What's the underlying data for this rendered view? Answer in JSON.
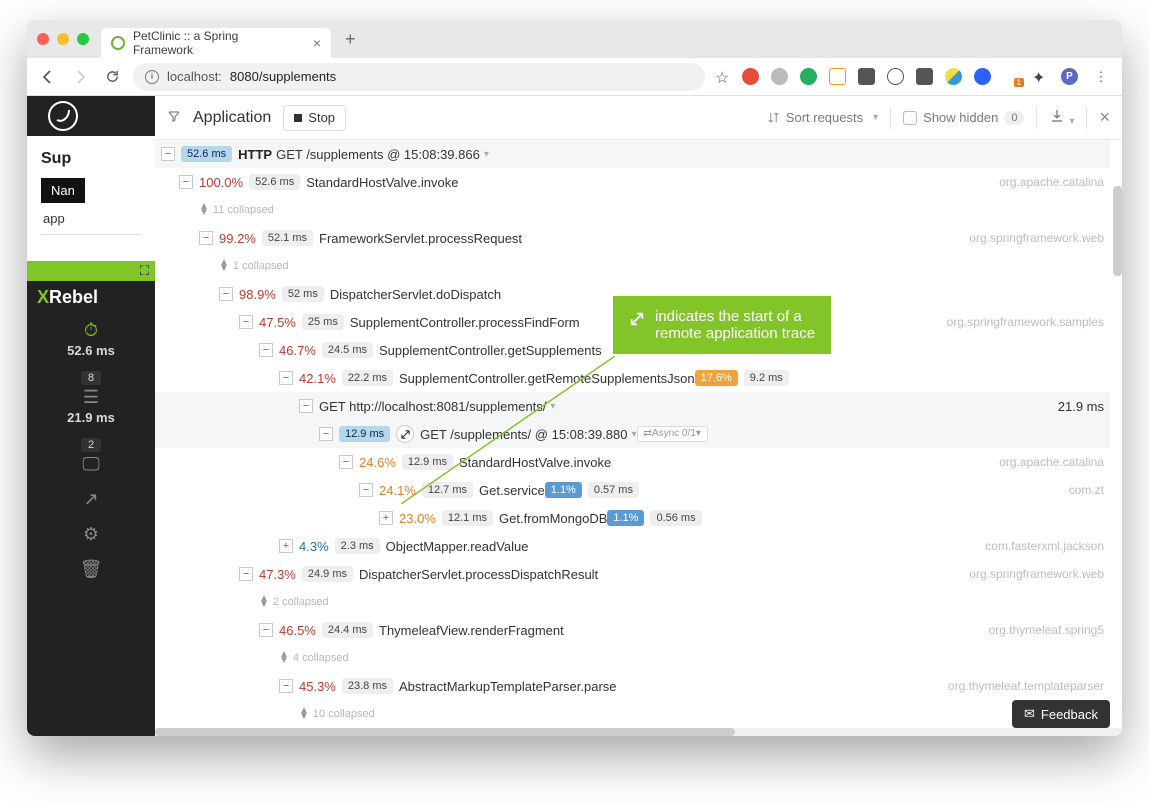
{
  "browser": {
    "tab_title": "PetClinic :: a Spring Framework",
    "url_host": "localhost:",
    "url_port_path": "8080/supplements"
  },
  "toolbar": {
    "title": "Application",
    "stop_label": "Stop",
    "sort_label": "Sort requests",
    "show_hidden_label": "Show hidden",
    "show_hidden_count": "0"
  },
  "xrebel": {
    "brand_prefix": "X",
    "brand_rest": "Rebel",
    "timer_ms": "52.6 ms",
    "db_badge": "8",
    "db_ms": "21.9 ms",
    "screen_badge": "2"
  },
  "sidebar": {
    "title": "Sup",
    "tab_label": "Nan",
    "tab_value": "app"
  },
  "callout": {
    "text1": "indicates the start of a",
    "text2": "remote application trace"
  },
  "feedback_label": "Feedback",
  "trace": {
    "root": {
      "ms": "52.6 ms",
      "proto": "HTTP",
      "req": "GET /supplements @ 15:08:39.866"
    },
    "r1": {
      "pct": "100.0%",
      "ms": "52.6 ms",
      "method": "StandardHostValve.invoke",
      "pkg": "org.apache.catalina"
    },
    "c1": "11 collapsed",
    "r2": {
      "pct": "99.2%",
      "ms": "52.1 ms",
      "method": "FrameworkServlet.processRequest",
      "pkg": "org.springframework.web"
    },
    "c2": "1 collapsed",
    "r3": {
      "pct": "98.9%",
      "ms": "52 ms",
      "method": "DispatcherServlet.doDispatch"
    },
    "r4": {
      "pct": "47.5%",
      "ms": "25 ms",
      "method": "SupplementController.processFindForm",
      "pkg": "org.springframework.samples"
    },
    "r5": {
      "pct": "46.7%",
      "ms": "24.5 ms",
      "method": "SupplementController.getSupplements"
    },
    "r6": {
      "pct": "42.1%",
      "ms": "22.2 ms",
      "method": "SupplementController.getRemoteSupplementsJson",
      "badge_pct": "17.6%",
      "badge_ms": "9.2 ms"
    },
    "r7": {
      "req": "GET http://localhost:8081/supplements/",
      "right_ms": "21.9 ms"
    },
    "r8": {
      "ms": "12.9 ms",
      "req": "GET /supplements/ @ 15:08:39.880",
      "async": "Async 0/1"
    },
    "r9": {
      "pct": "24.6%",
      "ms": "12.9 ms",
      "method": "StandardHostValve.invoke",
      "pkg": "org.apache.catalina"
    },
    "r10": {
      "pct": "24.1%",
      "ms": "12.7 ms",
      "method": "Get.service",
      "badge_pct": "1.1%",
      "badge_ms": "0.57 ms",
      "pkg": "com.zt"
    },
    "r11": {
      "pct": "23.0%",
      "ms": "12.1 ms",
      "method": "Get.fromMongoDB",
      "badge_pct": "1.1%",
      "badge_ms": "0.56 ms"
    },
    "r12": {
      "pct": "4.3%",
      "ms": "2.3 ms",
      "method": "ObjectMapper.readValue",
      "pkg": "com.fasterxml.jackson"
    },
    "r13": {
      "pct": "47.3%",
      "ms": "24.9 ms",
      "method": "DispatcherServlet.processDispatchResult",
      "pkg": "org.springframework.web"
    },
    "c13": "2 collapsed",
    "r14": {
      "pct": "46.5%",
      "ms": "24.4 ms",
      "method": "ThymeleafView.renderFragment",
      "pkg": "org.thymeleaf.spring5"
    },
    "c14": "4 collapsed",
    "r15": {
      "pct": "45.3%",
      "ms": "23.8 ms",
      "method": "AbstractMarkupTemplateParser.parse",
      "pkg": "org.thymeleaf.templateparser"
    },
    "c15": "10 collapsed"
  }
}
